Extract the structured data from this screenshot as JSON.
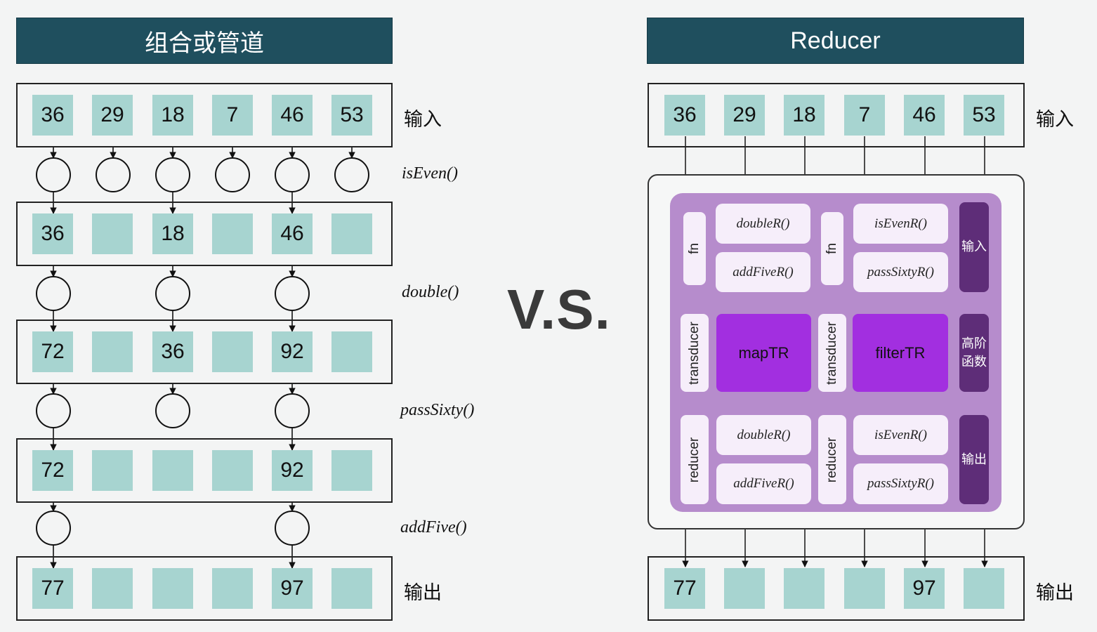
{
  "left_title": "组合或管道",
  "right_title": "Reducer",
  "vs_text": "V.S.",
  "labels": {
    "input": "输入",
    "output": "输出"
  },
  "left_pipeline": {
    "rows": [
      [
        "36",
        "29",
        "18",
        "7",
        "46",
        "53"
      ],
      [
        "36",
        "",
        "18",
        "",
        "46",
        ""
      ],
      [
        "72",
        "",
        "36",
        "",
        "92",
        ""
      ],
      [
        "72",
        "",
        "",
        "",
        "92",
        ""
      ],
      [
        "77",
        "",
        "",
        "",
        "97",
        ""
      ]
    ],
    "functions": [
      "isEven()",
      "double()",
      "passSixty()",
      "addFive()"
    ]
  },
  "right_pipeline": {
    "input_row": [
      "36",
      "29",
      "18",
      "7",
      "46",
      "53"
    ],
    "output_row": [
      "77",
      "",
      "",
      "",
      "97",
      ""
    ],
    "fn_tab": "fn",
    "transducer_tab": "transducer",
    "reducer_tab": "reducer",
    "top_left_fns": [
      "doubleR()",
      "addFiveR()"
    ],
    "top_right_fns": [
      "isEvenR()",
      "passSixtyR()"
    ],
    "core_left": "mapTR",
    "core_right": "filterTR",
    "bottom_left_fns": [
      "doubleR()",
      "addFiveR()"
    ],
    "bottom_right_fns": [
      "isEvenR()",
      "passSixtyR()"
    ],
    "side_tabs": {
      "top": "输入",
      "middle": "高阶函数",
      "bottom": "输出"
    }
  },
  "colors": {
    "banner": "#1f4f5e",
    "cell": "#a7d4d0",
    "panel": "#b68ccc",
    "core": "#a22fe0",
    "dark_tab": "#5e2d78"
  }
}
